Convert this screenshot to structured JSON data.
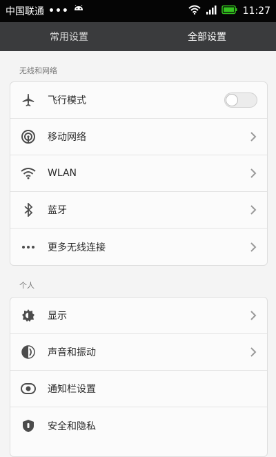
{
  "status_bar": {
    "carrier": "中国联通",
    "time": "11:27"
  },
  "tabs": [
    {
      "label": "常用设置",
      "active": false
    },
    {
      "label": "全部设置",
      "active": true
    }
  ],
  "sections": [
    {
      "title": "无线和网络",
      "items": [
        {
          "label": "飞行模式",
          "icon": "airplane-icon",
          "control": "toggle",
          "on": false
        },
        {
          "label": "移动网络",
          "icon": "cellular-signal-icon",
          "control": "chevron"
        },
        {
          "label": "WLAN",
          "icon": "wifi-icon",
          "control": "chevron"
        },
        {
          "label": "蓝牙",
          "icon": "bluetooth-icon",
          "control": "chevron"
        },
        {
          "label": "更多无线连接",
          "icon": "more-dots-icon",
          "control": "chevron"
        }
      ]
    },
    {
      "title": "个人",
      "items": [
        {
          "label": "显示",
          "icon": "brightness-icon",
          "control": "chevron"
        },
        {
          "label": "声音和振动",
          "icon": "sound-icon",
          "control": "chevron"
        },
        {
          "label": "通知栏设置",
          "icon": "notification-icon",
          "control": "none"
        },
        {
          "label": "安全和隐私",
          "icon": "shield-icon",
          "control": "none"
        }
      ]
    }
  ],
  "colors": {
    "status_bar_bg": "#050505",
    "tab_bar_bg": "#3a3b3d",
    "page_bg": "#f4f4f4",
    "battery_green": "#34c21f"
  }
}
